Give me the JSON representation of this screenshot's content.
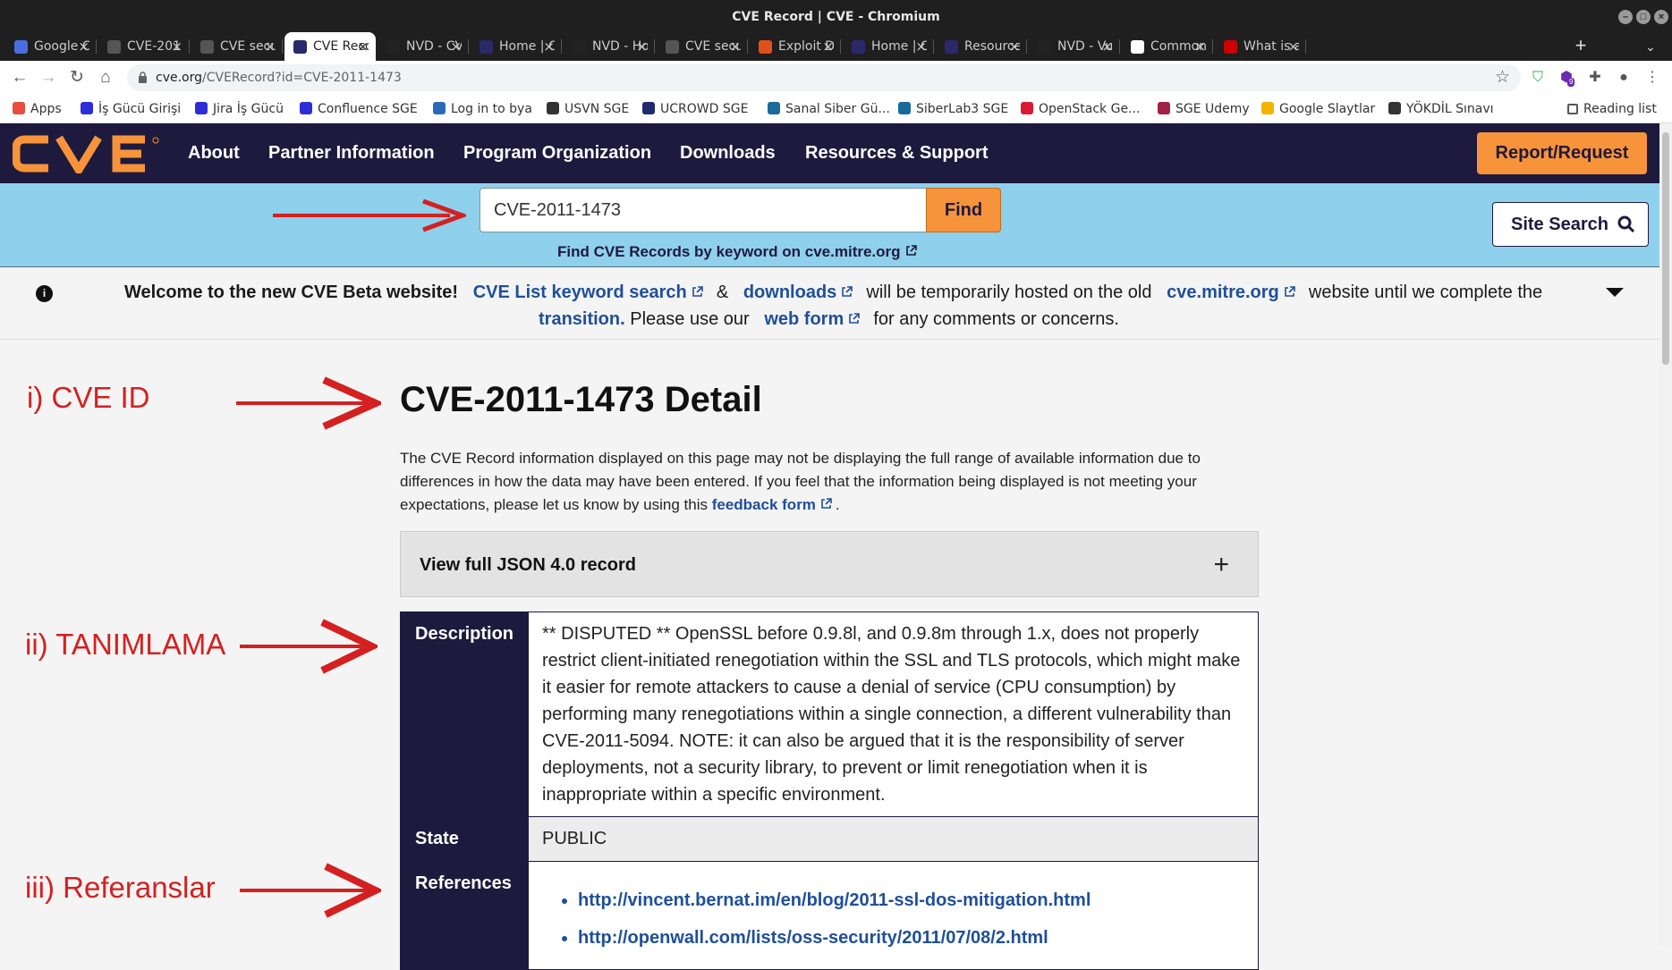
{
  "window": {
    "title": "CVE Record | CVE - Chromium"
  },
  "tabs": [
    {
      "label": "Google C",
      "icon": "google-docs-icon",
      "color": "#4a6ee0",
      "active": false
    },
    {
      "label": "CVE-201",
      "icon": "globe-icon",
      "color": "#555555",
      "active": false
    },
    {
      "label": "CVE secu",
      "icon": "globe-icon",
      "color": "#555555",
      "active": false
    },
    {
      "label": "CVE Reco",
      "icon": "cve-v-icon",
      "color": "#2a2a6a",
      "active": true
    },
    {
      "label": "NVD - CV",
      "icon": "nvd-icon",
      "color": "#222222",
      "active": false
    },
    {
      "label": "Home | C",
      "icon": "cve-v-icon",
      "color": "#2a2a6a",
      "active": false
    },
    {
      "label": "NVD - Ho",
      "icon": "nvd-icon",
      "color": "#222222",
      "active": false
    },
    {
      "label": "CVE secu",
      "icon": "globe-icon",
      "color": "#555555",
      "active": false
    },
    {
      "label": "Exploit D",
      "icon": "exploit-db-icon",
      "color": "#e0501a",
      "active": false
    },
    {
      "label": "Home | C",
      "icon": "cve-v-icon",
      "color": "#2a2a6a",
      "active": false
    },
    {
      "label": "Resource",
      "icon": "cve-v-icon",
      "color": "#2a2a6a",
      "active": false
    },
    {
      "label": "NVD - Vu",
      "icon": "nvd-icon",
      "color": "#222222",
      "active": false
    },
    {
      "label": "Common",
      "icon": "wikipedia-icon",
      "color": "#ffffff",
      "active": false
    },
    {
      "label": "What is a",
      "icon": "redhat-icon",
      "color": "#cc0000",
      "active": false
    }
  ],
  "address_bar": {
    "domain": "cve.org",
    "path": "/CVERecord?id=CVE-2011-1473"
  },
  "extensions": {
    "badge": "9"
  },
  "bookmarks": [
    {
      "label": "Apps",
      "color": "#e84c3d"
    },
    {
      "label": "İş Gücü Girişi",
      "color": "#2d2dd8"
    },
    {
      "label": "Jira İş Gücü",
      "color": "#2d2dd8"
    },
    {
      "label": "Confluence SGE",
      "color": "#2d2dd8"
    },
    {
      "label": "Log in to bya",
      "color": "#2a6ab8"
    },
    {
      "label": "USVN SGE",
      "color": "#333333"
    },
    {
      "label": "UCROWD SGE",
      "color": "#1f2b6e"
    },
    {
      "label": "Sanal Siber Gü...",
      "color": "#1a6a9a"
    },
    {
      "label": "SiberLab3 SGE",
      "color": "#1a6a9a"
    },
    {
      "label": "OpenStack Ge...",
      "color": "#da1a32"
    },
    {
      "label": "SGE Udemy",
      "color": "#a0214a"
    },
    {
      "label": "Google Slaytlar",
      "color": "#f4b400"
    },
    {
      "label": "YÖKDİL Sınavı",
      "color": "#333333"
    }
  ],
  "reading_list": "Reading list",
  "site_nav": {
    "links": [
      "About",
      "Partner Information",
      "Program Organization",
      "Downloads",
      "Resources & Support"
    ],
    "report": "Report/Request"
  },
  "search": {
    "value": "CVE-2011-1473",
    "find": "Find",
    "keyword_link": "Find CVE Records by keyword on cve.mitre.org",
    "site_search": "Site Search"
  },
  "banner": {
    "welcome": "Welcome to the new CVE Beta website!",
    "keyword_search": "CVE List keyword search",
    "amp": "&",
    "downloads": "downloads",
    "mid": "will be temporarily hosted on the old",
    "mitre": "cve.mitre.org",
    "until": "website until we complete the",
    "transition": "transition.",
    "please": "Please use our",
    "web_form": "web form",
    "comments": "for any comments or concerns."
  },
  "record": {
    "title": "CVE-2011-1473 Detail",
    "intro_text": "The CVE Record information displayed on this page may not be displaying the full range of available information due to differences in how the data may have been entered. If you feel that the information being displayed is not meeting your expectations, please let us know by using this",
    "feedback_link": "feedback form",
    "intro_end": ".",
    "json_label": "View full JSON 4.0 record",
    "json_plus": "+",
    "description_label": "Description",
    "description": "** DISPUTED ** OpenSSL before 0.9.8l, and 0.9.8m through 1.x, does not properly restrict client-initiated renegotiation within the SSL and TLS protocols, which might make it easier for remote attackers to cause a denial of service (CPU consumption) by performing many renegotiations within a single connection, a different vulnerability than CVE-2011-5094. NOTE: it can also be argued that it is the responsibility of server deployments, not a security library, to prevent or limit renegotiation when it is inappropriate within a specific environment.",
    "state_label": "State",
    "state": "PUBLIC",
    "references_label": "References",
    "references": [
      "http://vincent.bernat.im/en/blog/2011-ssl-dos-mitigation.html",
      "http://openwall.com/lists/oss-security/2011/07/08/2.html"
    ]
  },
  "annotations": {
    "cve_id": "i) CVE ID",
    "tanimlama": "ii) TANIMLAMA",
    "referanslar": "iii) Referanslar",
    "color": "#d42020"
  }
}
